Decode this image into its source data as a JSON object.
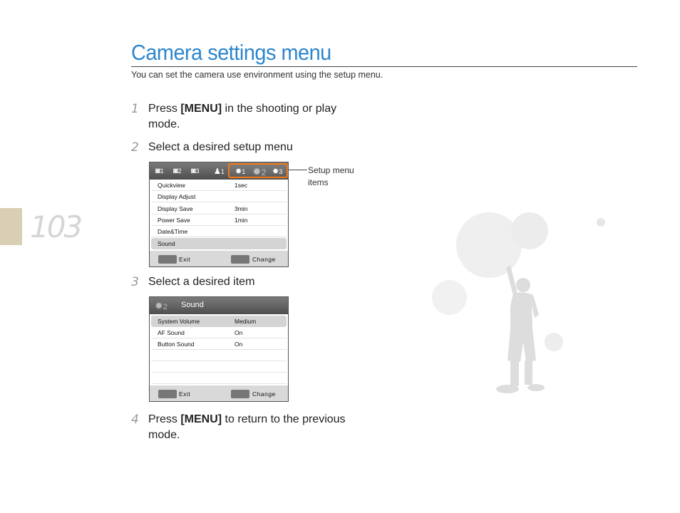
{
  "page": {
    "number": "103",
    "title": "Camera settings menu",
    "subtitle": "You can set the camera use environment using the setup menu."
  },
  "steps": [
    {
      "num": "1",
      "pre": "Press ",
      "bold": "[MENU]",
      "post": " in the shooting or play mode."
    },
    {
      "num": "2",
      "pre": "Select a desired setup menu",
      "bold": "",
      "post": ""
    },
    {
      "num": "3",
      "pre": "Select a desired item",
      "bold": "",
      "post": ""
    },
    {
      "num": "4",
      "pre": "Press ",
      "bold": "[MENU]",
      "post": " to return to the previous mode."
    }
  ],
  "callout": {
    "text": "Setup menu items"
  },
  "screen1": {
    "tabs": [
      "1",
      "2",
      "3",
      "1",
      "1",
      "2",
      "3"
    ],
    "rows": [
      {
        "label": "Quickview",
        "value": "1sec",
        "selected": false
      },
      {
        "label": "Display Adjust",
        "value": "",
        "selected": false
      },
      {
        "label": "Display Save",
        "value": "3min",
        "selected": false
      },
      {
        "label": "Power Save",
        "value": "1min",
        "selected": false
      },
      {
        "label": "Date&Time",
        "value": "",
        "selected": false
      },
      {
        "label": "Sound",
        "value": "",
        "selected": true
      }
    ],
    "exit_label": "Exit",
    "change_label": "Change"
  },
  "screen2": {
    "header_num": "2",
    "header_title": "Sound",
    "rows": [
      {
        "label": "System Volume",
        "value": "Medium",
        "selected": true
      },
      {
        "label": "AF Sound",
        "value": "On",
        "selected": false
      },
      {
        "label": "Button Sound",
        "value": "On",
        "selected": false
      },
      {
        "label": "",
        "value": "",
        "selected": false
      },
      {
        "label": "",
        "value": "",
        "selected": false
      },
      {
        "label": "",
        "value": "",
        "selected": false
      }
    ],
    "exit_label": "Exit",
    "change_label": "Change"
  },
  "colors": {
    "title": "#2e86cc",
    "accent": "#f07a1a",
    "tab": "#d8cfb4"
  }
}
